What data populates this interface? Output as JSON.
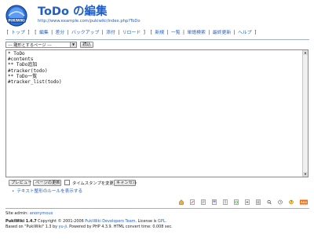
{
  "header": {
    "title_main": "ToDo",
    "title_suffix": " の編集",
    "url": "http://www.example.com/pukiwiki/index.php?ToDo",
    "logo_text": "PUKIWIKI"
  },
  "menu": {
    "top": "トップ",
    "edit": "編集",
    "diff": "差分",
    "backup": "バックアップ",
    "attach": "添付",
    "reload": "リロード",
    "new": "新規",
    "list": "一覧",
    "search": "単語検索",
    "recent": "最終更新",
    "help": "ヘルプ"
  },
  "editor": {
    "template_select": "--- 雛形とするページ ---",
    "load_button": "読込",
    "content": "* ToDo\n#contents\n** ToDo追加\n#tracker(todo)\n** ToDo一覧\n#tracker_list(todo)"
  },
  "actions": {
    "preview": "プレビュー",
    "update": "ページの更新",
    "notimestamp": "タイムスタンプを変更しない",
    "cancel": "キャンセル",
    "rules_link": "テキスト整形のルールを表示する"
  },
  "toolbar_icons": [
    "home-icon",
    "edit-icon",
    "diff-icon",
    "backup-icon",
    "attach-icon",
    "reload-icon",
    "new-icon",
    "list-icon",
    "search-icon",
    "recent-icon",
    "help-icon",
    "rss-icon"
  ],
  "footer": {
    "site_admin_label": "Site admin: ",
    "site_admin_name": "anonymous",
    "line1_product": "PukiWiki 1.4.7",
    "line1_copy": " Copyright © 2001-2006 ",
    "line1_team": "PukiWiki Developers Team",
    "line1_license": ". License is ",
    "line1_gpl": "GPL",
    "line2_based": "Based on \"PukiWiki\" 1.3 by ",
    "line2_author": "yu-ji",
    "line2_rest": ". Powered by PHP 4.3.9. HTML convert time: 0.008 sec."
  },
  "colors": {
    "link": "#215dc6",
    "rule": "#9fb0c7",
    "rss": "#ff6600"
  }
}
